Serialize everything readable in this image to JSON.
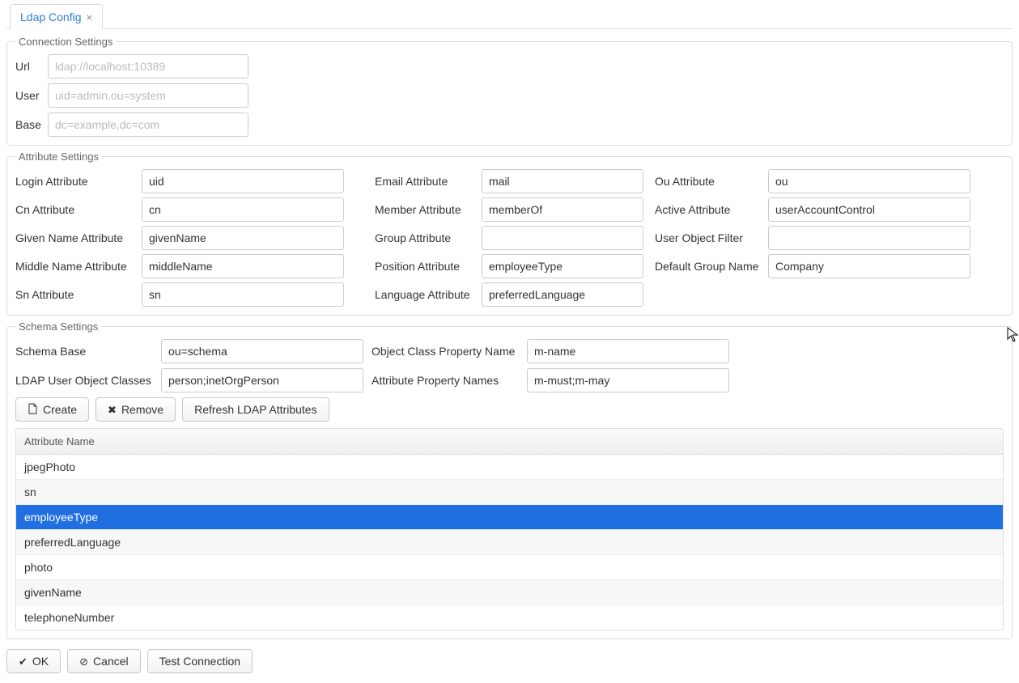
{
  "tab": {
    "label": "Ldap Config"
  },
  "connection": {
    "legend": "Connection Settings",
    "url_label": "Url",
    "url_placeholder": "ldap://localhost:10389",
    "user_label": "User",
    "user_placeholder": "uid=admin,ou=system",
    "base_label": "Base",
    "base_placeholder": "dc=example,dc=com"
  },
  "attributes": {
    "legend": "Attribute Settings",
    "login_label": "Login Attribute",
    "login_value": "uid",
    "email_label": "Email Attribute",
    "email_value": "mail",
    "ou_label": "Ou Attribute",
    "ou_value": "ou",
    "cn_label": "Cn Attribute",
    "cn_value": "cn",
    "member_label": "Member Attribute",
    "member_value": "memberOf",
    "active_label": "Active Attribute",
    "active_value": "userAccountControl",
    "given_label": "Given Name Attribute",
    "given_value": "givenName",
    "group_label": "Group Attribute",
    "group_value": "",
    "uof_label": "User Object Filter",
    "uof_value": "",
    "middle_label": "Middle Name Attribute",
    "middle_value": "middleName",
    "position_label": "Position Attribute",
    "position_value": "employeeType",
    "defgroup_label": "Default Group Name",
    "defgroup_value": "Company",
    "sn_label": "Sn Attribute",
    "sn_value": "sn",
    "lang_label": "Language Attribute",
    "lang_value": "preferredLanguage"
  },
  "schema": {
    "legend": "Schema Settings",
    "base_label": "Schema Base",
    "base_value": "ou=schema",
    "ocpn_label": "Object Class Property Name",
    "ocpn_value": "m-name",
    "classes_label": "LDAP User Object Classes",
    "classes_value": "person;inetOrgPerson",
    "apn_label": "Attribute Property Names",
    "apn_value": "m-must;m-may",
    "create_label": "Create",
    "remove_label": "Remove",
    "refresh_label": "Refresh LDAP Attributes",
    "table_header": "Attribute Name",
    "rows": [
      {
        "name": "jpegPhoto",
        "selected": false
      },
      {
        "name": "sn",
        "selected": false
      },
      {
        "name": "employeeType",
        "selected": true
      },
      {
        "name": "preferredLanguage",
        "selected": false
      },
      {
        "name": "photo",
        "selected": false
      },
      {
        "name": "givenName",
        "selected": false
      },
      {
        "name": "telephoneNumber",
        "selected": false
      }
    ]
  },
  "footer": {
    "ok_label": "OK",
    "cancel_label": "Cancel",
    "test_label": "Test Connection"
  }
}
